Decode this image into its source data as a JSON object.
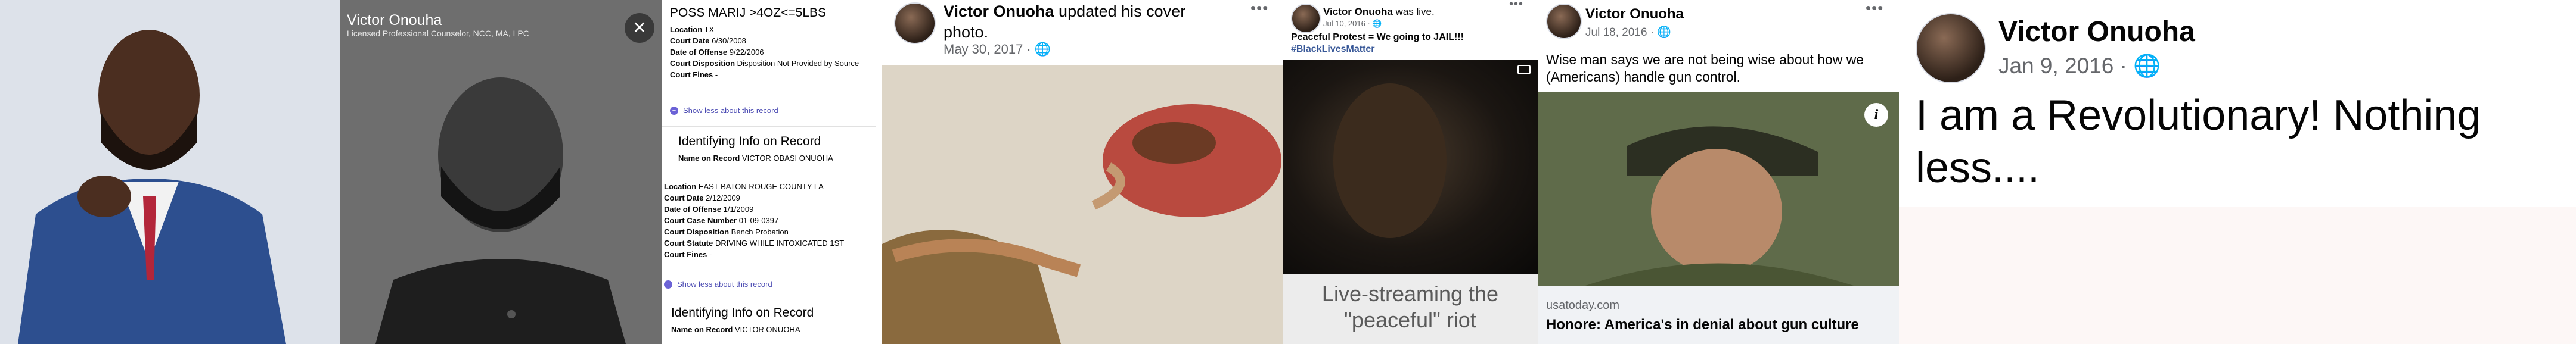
{
  "panel2": {
    "name": "Victor Onouha",
    "subtitle": "Licensed Professional Counselor, NCC, MA, LPC",
    "close_label": "✕"
  },
  "panel3": {
    "record1": {
      "title": "POSS MARIJ >4OZ<=5LBS",
      "fields": [
        {
          "k": "Location",
          "v": "TX"
        },
        {
          "k": "Court Date",
          "v": "6/30/2008"
        },
        {
          "k": "Date of Offense",
          "v": "9/22/2006"
        },
        {
          "k": "Court Disposition",
          "v": "Disposition Not Provided by Source"
        },
        {
          "k": "Court Fines",
          "v": "-"
        }
      ],
      "show_less": "Show less about this record"
    },
    "identifying1": {
      "title": "Identifying Info on Record",
      "name_label": "Name on Record",
      "name_value": "VICTOR OBASI ONUOHA"
    },
    "record2": {
      "fields": [
        {
          "k": "Location",
          "v": "EAST BATON ROUGE COUNTY LA"
        },
        {
          "k": "Court Date",
          "v": "2/12/2009"
        },
        {
          "k": "Date of Offense",
          "v": "1/1/2009"
        },
        {
          "k": "Court Case Number",
          "v": "01-09-0397"
        },
        {
          "k": "Court Disposition",
          "v": "Bench Probation"
        },
        {
          "k": "Court Statute",
          "v": "DRIVING WHILE INTOXICATED 1ST"
        },
        {
          "k": "Court Fines",
          "v": "-"
        }
      ],
      "show_less": "Show less about this record"
    },
    "identifying2": {
      "title": "Identifying Info on Record",
      "name_label": "Name on Record",
      "name_value": "VICTOR ONUOHA"
    }
  },
  "panel4": {
    "author": "Victor Onuoha",
    "action": "updated his cover photo.",
    "date": "May 30, 2017 · "
  },
  "panel5": {
    "author": "Victor Onuoha",
    "action": "was live.",
    "date": "Jul 10, 2016 · ",
    "message": "Peaceful Protest = We going to JAIL!!!",
    "hashtag": "#BlackLivesMatter",
    "caption": "Live-streaming the \"peaceful\" riot"
  },
  "panel6": {
    "author": "Victor Onuoha",
    "date": "Jul 18, 2016 · ",
    "body": "Wise man says we are not being wise about how we (Americans) handle gun control.",
    "link_domain": "usatoday.com",
    "link_headline": "Honore: America's in denial about gun culture"
  },
  "panel7": {
    "author": "Victor Onuoha",
    "date": "Jan 9, 2016 · ",
    "body": "I am a Revolutionary! Nothing less...."
  },
  "icons": {
    "globe": "globe-icon",
    "more": "more-options-icon",
    "info": "info-icon",
    "close": "close-icon"
  },
  "colors": {
    "link_blue": "#385898",
    "meta_gray": "#65676b",
    "record_purple": "#6b62d6"
  }
}
